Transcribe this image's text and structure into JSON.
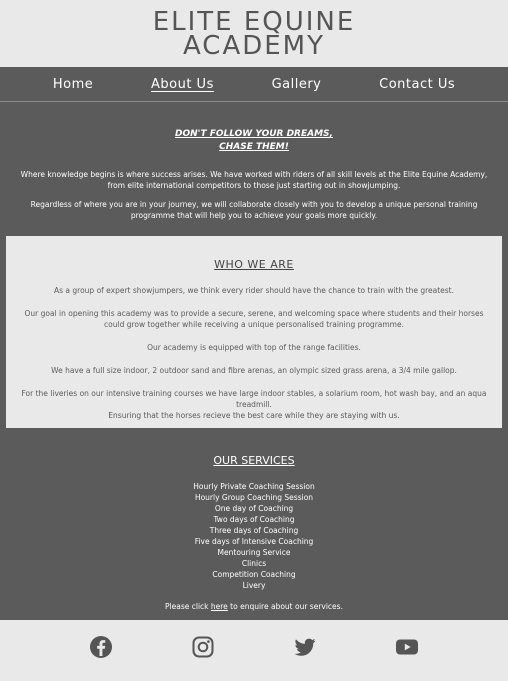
{
  "brand": {
    "line1": "ELITE EQUINE",
    "line2": "ACADEMY"
  },
  "nav": {
    "items": [
      {
        "label": "Home",
        "active": false
      },
      {
        "label": "About Us",
        "active": true
      },
      {
        "label": "Gallery",
        "active": false
      },
      {
        "label": "Contact Us",
        "active": false
      }
    ]
  },
  "hero": {
    "slogan_line1": "DON'T FOLLOW YOUR DREAMS,",
    "slogan_line2": "CHASE THEM!",
    "para1": "Where knowledge begins is where success arises. We have worked with riders of all skill levels at the Elite Equine Academy, from elite international competitors to those just starting out in showjumping.",
    "para2": "Regardless of where you are in your journey, we will collaborate closely with you to develop a unique personal training programme that will help you to achieve your goals more quickly."
  },
  "about": {
    "heading": "WHO WE ARE",
    "p1": "As a group of expert showjumpers, we think every rider should have the chance to train with the greatest.",
    "p2": "Our goal in opening this academy was to provide a secure, serene, and welcoming space where students and their horses could grow together while receiving a unique personalised training programme.",
    "p3": "Our academy is equipped with top of the range facilities.",
    "p4": "We have a full size indoor, 2 outdoor sand and fibre arenas, an olympic sized grass arena, a 3/4 mile gallop.",
    "p5": "For the liveries on our intensive training courses we have large indoor stables, a solarium room, hot wash bay, and an aqua treadmill.",
    "p6": "Ensuring that the horses recieve the best care while they are staying with us."
  },
  "services": {
    "heading": "OUR SERVICES",
    "items": [
      "Hourly Private Coaching Session",
      "Hourly Group Coaching Session",
      "One day of Coaching",
      "Two days of Coaching",
      "Three days of Coaching",
      "Five days of Intensive Coaching",
      "Mentouring Service",
      "Clinics",
      "Competition Coaching",
      "Livery"
    ],
    "note_before": "Please click ",
    "note_link": "here",
    "note_after": " to enquire about our services."
  },
  "footer": {
    "icons": [
      "facebook-icon",
      "instagram-icon",
      "twitter-icon",
      "youtube-icon"
    ],
    "icon_color": "#555555"
  },
  "colors": {
    "dark_band": "#5b5b5b",
    "light_band": "#e9e9e9"
  }
}
